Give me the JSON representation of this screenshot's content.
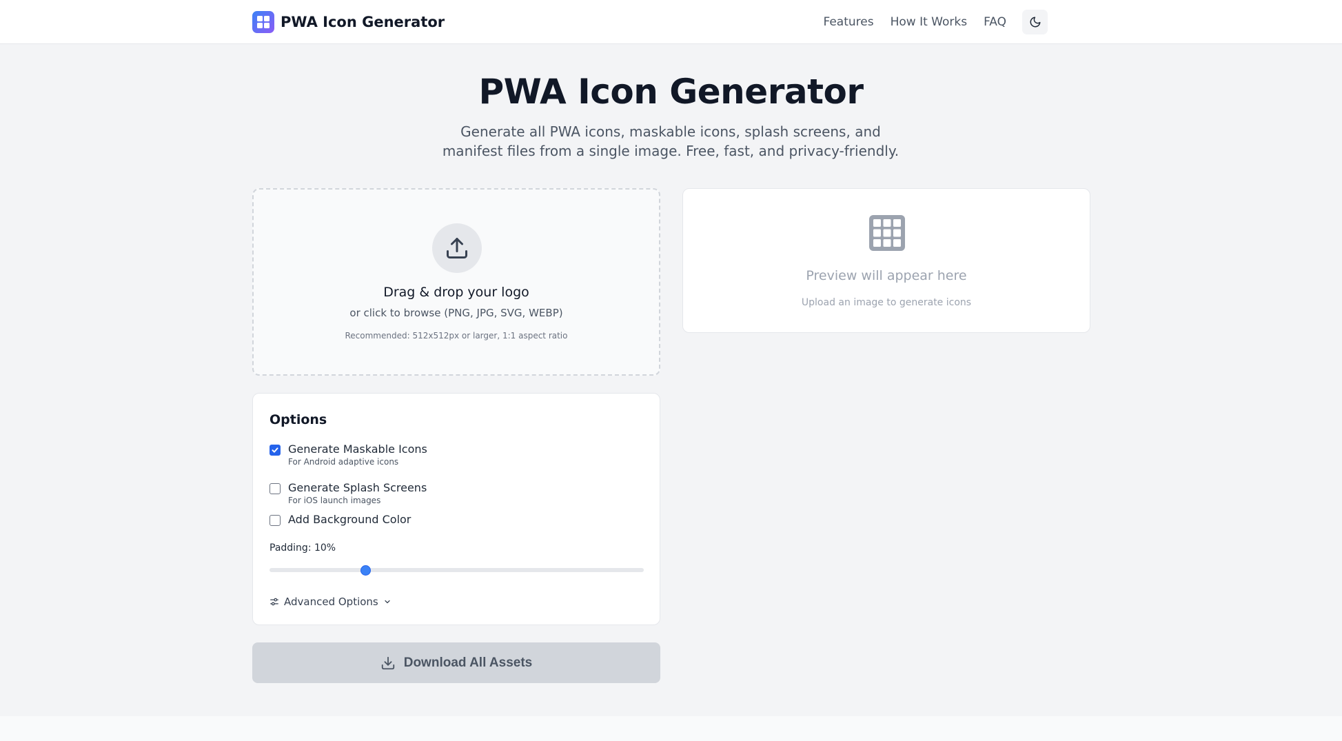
{
  "header": {
    "brand_name": "PWA Icon Generator",
    "nav": [
      "Features",
      "How It Works",
      "FAQ"
    ]
  },
  "hero": {
    "title": "PWA Icon Generator",
    "subtitle": "Generate all PWA icons, maskable icons, splash screens, and manifest files from a single image. Free, fast, and privacy-friendly."
  },
  "upload": {
    "title": "Drag & drop your logo",
    "subtitle": "or click to browse (PNG, JPG, SVG, WEBP)",
    "recommendation": "Recommended: 512x512px or larger, 1:1 aspect ratio"
  },
  "preview": {
    "title": "Preview will appear here",
    "subtitle": "Upload an image to generate icons"
  },
  "options": {
    "title": "Options",
    "maskable": {
      "label": "Generate Maskable Icons",
      "hint": "For Android adaptive icons",
      "checked": true
    },
    "splash": {
      "label": "Generate Splash Screens",
      "hint": "For iOS launch images",
      "checked": false
    },
    "background": {
      "label": "Add Background Color",
      "checked": false
    },
    "padding_label": "Padding: 10%",
    "padding_fraction": 0.25,
    "advanced_label": "Advanced Options"
  },
  "download": {
    "label": "Download All Assets",
    "disabled": true
  },
  "colors": {
    "accent": "#2563eb",
    "brand_gradient_start": "#3b82f6",
    "brand_gradient_end": "#8b5cf6",
    "page_background": "#f3f4f6",
    "disabled_button": "#d1d5db"
  },
  "icons": [
    "app-grid-icon",
    "moon-icon",
    "upload-icon",
    "grid-icon",
    "sliders-icon",
    "chevron-down-icon",
    "download-icon"
  ]
}
